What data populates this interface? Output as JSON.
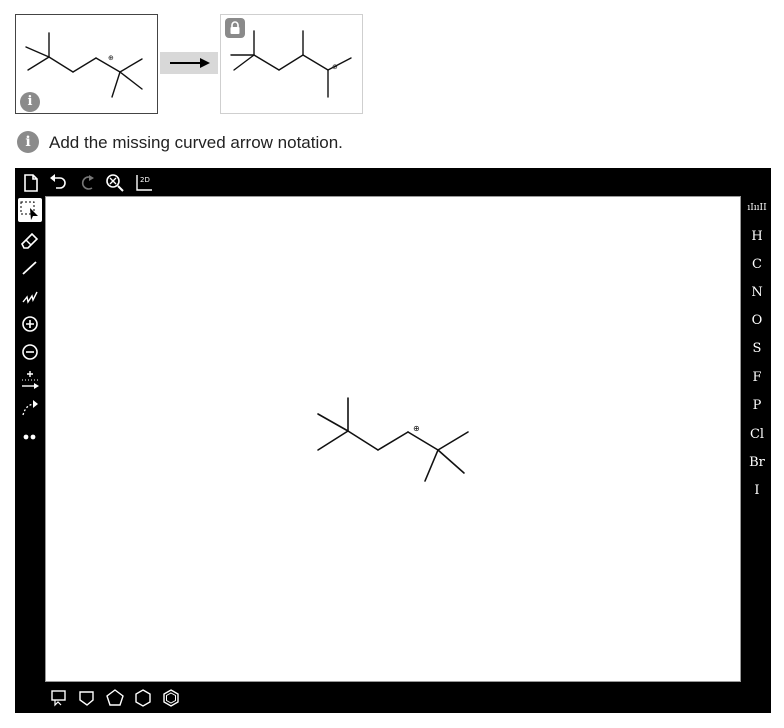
{
  "instruction": {
    "text": "Add the missing curved arrow notation.",
    "info_glyph": "i"
  },
  "reaction": {
    "left_info_glyph": "i",
    "reactant_charge_symbol": "⊕",
    "product_charge_symbol": "⊕"
  },
  "editor": {
    "top_toolbar": [
      "new-document-icon",
      "undo-icon",
      "redo-icon",
      "zoom-clear-icon",
      "2d-clean-icon"
    ],
    "top_toolbar_2d_label": "2D",
    "left_toolbar": [
      "select-tool-icon",
      "eraser-icon",
      "bond-icon",
      "chain-icon",
      "positive-charge-icon",
      "negative-charge-icon",
      "increase-charge-arrow-icon",
      "curved-arrow-icon",
      "lone-pair-icon"
    ],
    "element_label_top": "ıIııII",
    "elements": [
      "H",
      "C",
      "N",
      "O",
      "S",
      "F",
      "P",
      "Cl",
      "Br",
      "I"
    ],
    "bottom_toolbar": [
      "template-icon",
      "square-ring-icon",
      "pentagon-ring-icon",
      "hexagon-ring-icon",
      "benzene-ring-icon"
    ],
    "canvas_charge_symbol": "⊕"
  },
  "colors": {
    "editor_bg": "#000000",
    "canvas_bg": "#ffffff",
    "icon_gray": "#8b8b8b",
    "panel_band": "#d8d8d8"
  }
}
